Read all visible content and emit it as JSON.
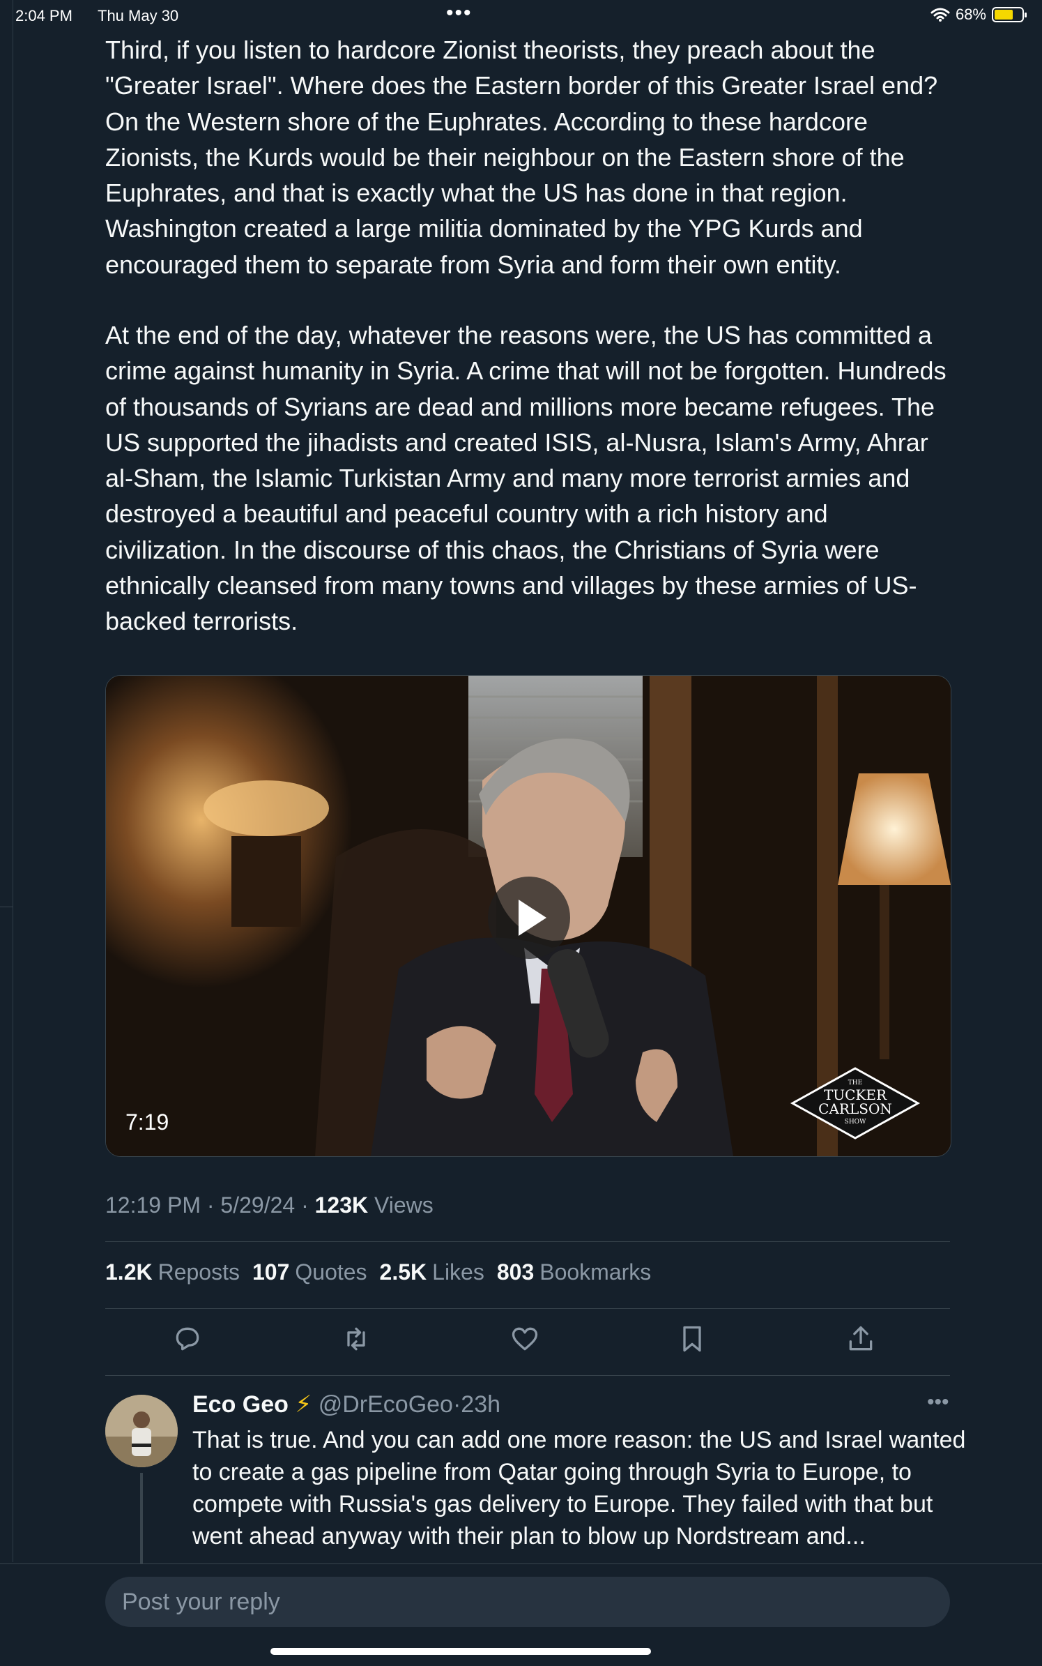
{
  "status": {
    "time": "2:04 PM",
    "date": "Thu May 30",
    "dots": "•••",
    "battery": "68%"
  },
  "tweet": {
    "para1": "Third, if you listen to hardcore Zionist theorists, they preach about the \"Greater Israel\". Where does the Eastern border of this Greater Israel end? On the Western shore of the Euphrates. According to these hardcore Zionists, the Kurds would be their neighbour on the Eastern shore of the Euphrates, and that is exactly what the US has done in that region. Washington created a large militia dominated by the YPG Kurds and encouraged them to separate from Syria and form their own entity.",
    "para2": "At the end of the day, whatever the reasons were, the US has committed a crime against humanity in Syria. A crime that will not be forgotten. Hundreds of thousands of Syrians are dead and millions more became refugees. The US supported the jihadists and created ISIS, al-Nusra, Islam's Army, Ahrar al-Sham, the Islamic Turkistan Army and many more terrorist armies and destroyed a beautiful and peaceful country with a rich history and civilization. In the discourse of this chaos, the Christians of Syria were ethnically cleansed from many towns and villages by these armies of US-backed terrorists.",
    "video_duration": "7:19",
    "brand_the": "THE",
    "brand_line1": "TUCKER",
    "brand_line2": "CARLSON",
    "brand_show": "SHOW",
    "timestamp": "12:19 PM · 5/29/24 · ",
    "views_count": "123K",
    "views_label": " Views",
    "stats": {
      "reposts_count": "1.2K",
      "reposts_label": "Reposts",
      "quotes_count": "107",
      "quotes_label": "Quotes",
      "likes_count": "2.5K",
      "likes_label": "Likes",
      "bookmarks_count": "803",
      "bookmarks_label": "Bookmarks"
    }
  },
  "actions": [
    "reply-icon",
    "repost-icon",
    "like-icon",
    "bookmark-icon",
    "share-icon"
  ],
  "reply": {
    "name": "Eco Geo",
    "badge": "⚡",
    "handle": "@DrEcoGeo",
    "sep": "·",
    "time": "23h",
    "more": "•••",
    "text": "That is true. And you can add one more reason: the US and Israel wanted to create a gas pipeline  from Qatar going through Syria to Europe, to compete with Russia's gas delivery to Europe. They failed with that but went ahead anyway with their plan to blow up Nordstream and..."
  },
  "compose": {
    "placeholder": "Post your reply"
  },
  "colors": {
    "background": "#15202b",
    "text": "#f7f9f9",
    "muted": "#8b98a5",
    "divider": "#38444d",
    "battery": "#f5d800"
  }
}
